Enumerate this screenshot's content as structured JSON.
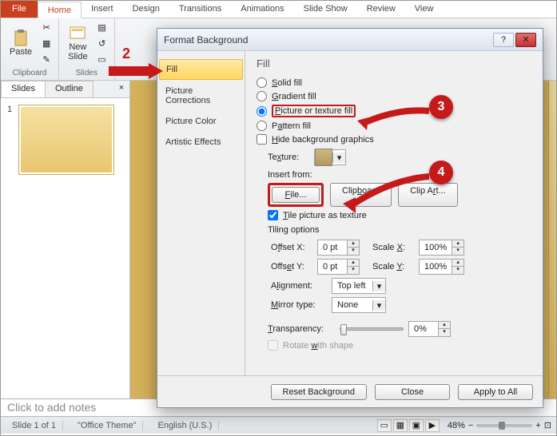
{
  "ribbon": {
    "tabs": {
      "file": "File",
      "home": "Home",
      "insert": "Insert",
      "design": "Design",
      "transitions": "Transitions",
      "animations": "Animations",
      "slideshow": "Slide Show",
      "review": "Review",
      "view": "View"
    },
    "paste": "Paste",
    "new_slide": "New\nSlide",
    "clipboard_group": "Clipboard",
    "slides_group": "Slides"
  },
  "pane": {
    "slides_tab": "Slides",
    "outline_tab": "Outline",
    "slide_num": "1"
  },
  "notes_placeholder": "Click to add notes",
  "status": {
    "slide": "Slide 1 of 1",
    "theme": "\"Office Theme\"",
    "lang": "English (U.S.)",
    "zoom": "48%"
  },
  "dialog": {
    "title": "Format Background",
    "nav": {
      "fill": "Fill",
      "picture_corrections": "Picture Corrections",
      "picture_color": "Picture Color",
      "artistic_effects": "Artistic Effects"
    },
    "content": {
      "heading": "Fill",
      "solid": "Solid fill",
      "gradient": "Gradient fill",
      "picture": "Picture or texture fill",
      "pattern": "Pattern fill",
      "hide_bg": "Hide background graphics",
      "texture_label": "Texture:",
      "insert_from": "Insert from:",
      "file_btn": "File...",
      "clipboard_btn": "Clipboard",
      "clipart_btn": "Clip Art...",
      "tile": "Tile picture as texture",
      "tiling_options": "Tiling options",
      "offset_x": "Offset X:",
      "offset_y": "Offset Y:",
      "scale_x": "Scale X:",
      "scale_y": "Scale Y:",
      "offset_x_val": "0 pt",
      "offset_y_val": "0 pt",
      "scale_x_val": "100%",
      "scale_y_val": "100%",
      "alignment": "Alignment:",
      "alignment_val": "Top left",
      "mirror": "Mirror type:",
      "mirror_val": "None",
      "transparency": "Transparency:",
      "transparency_val": "0%",
      "rotate": "Rotate with shape"
    },
    "buttons": {
      "reset": "Reset Background",
      "close": "Close",
      "apply_all": "Apply to All"
    }
  },
  "annotations": {
    "n2": "2",
    "n3": "3",
    "n4": "4"
  }
}
